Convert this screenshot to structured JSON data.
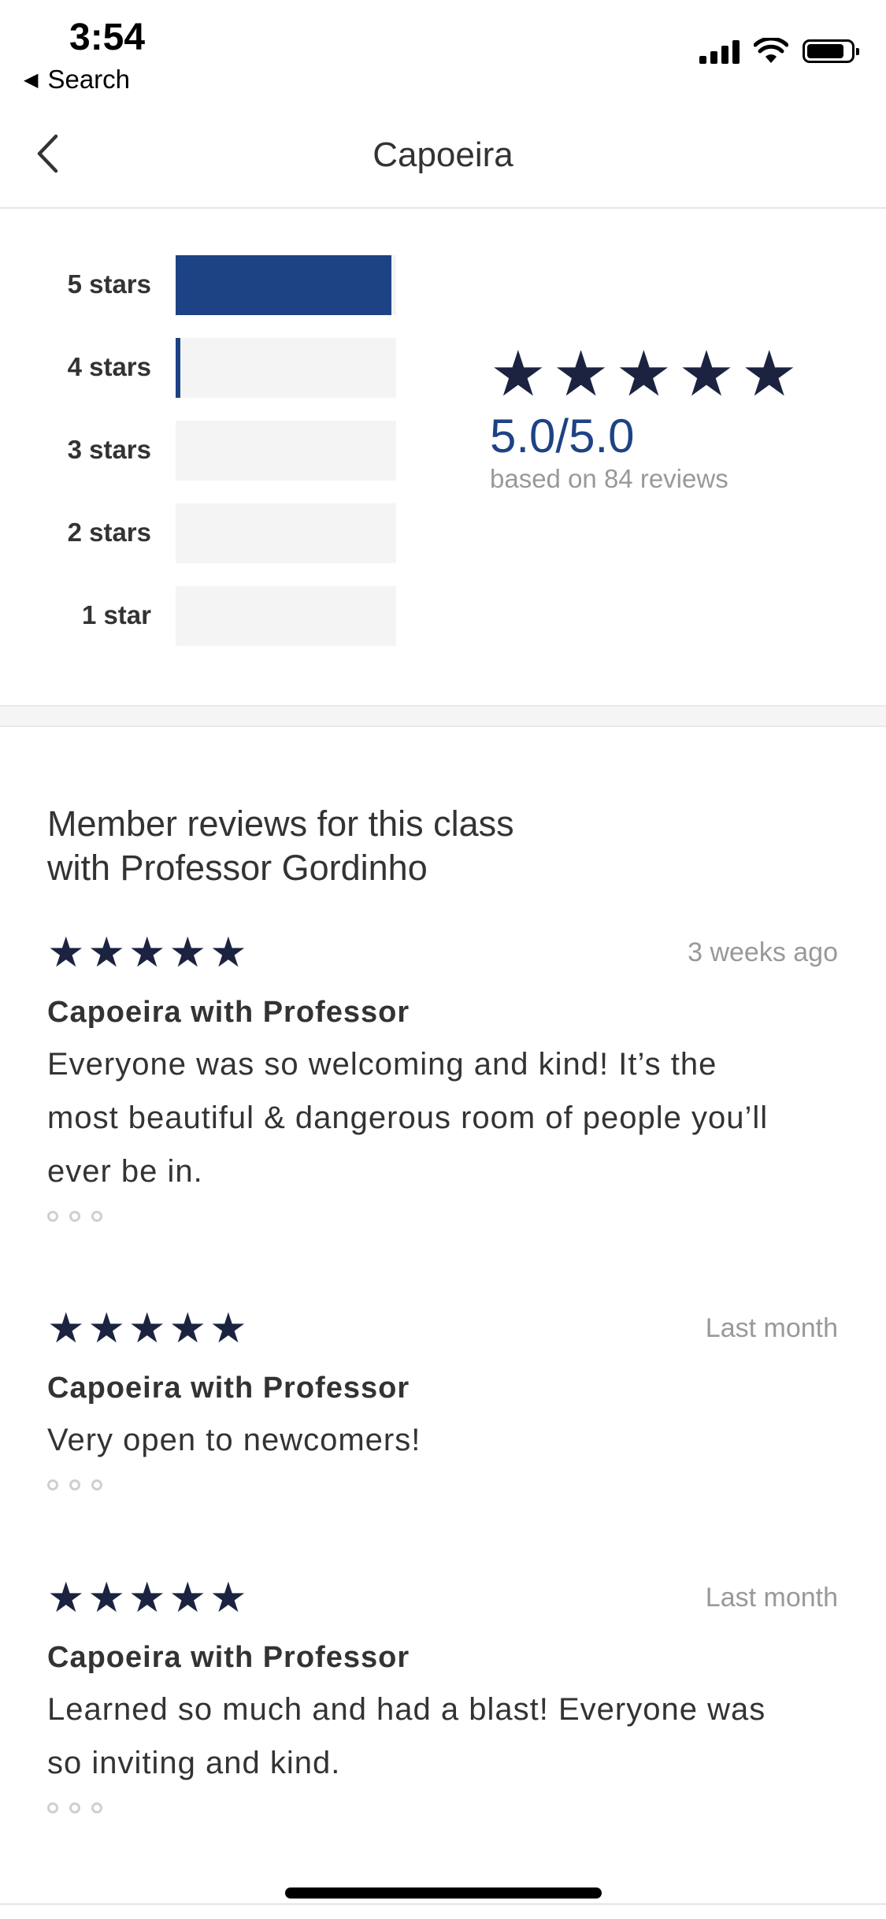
{
  "status_bar": {
    "time": "3:54",
    "back_app_label": "Search",
    "icons": [
      "signal-icon",
      "wifi-icon",
      "battery-icon"
    ]
  },
  "nav": {
    "title": "Capoeira",
    "back_icon": "chevron-left-icon"
  },
  "summary": {
    "rows": [
      {
        "label": "5 stars",
        "fraction": 0.98
      },
      {
        "label": "4 stars",
        "fraction": 0.02
      },
      {
        "label": "3 stars",
        "fraction": 0
      },
      {
        "label": "2 stars",
        "fraction": 0
      },
      {
        "label": "1 star",
        "fraction": 0
      }
    ],
    "star_count": 5,
    "average": "5.0/5.0",
    "based_on": "based on 84 reviews",
    "colors": {
      "bar_fill": "#1d4385",
      "bar_track": "#f4f4f4",
      "star": "#1b2340"
    }
  },
  "reviews": {
    "heading_line1": "Member reviews for this class",
    "heading_line2": "with Professor Gordinho",
    "items": [
      {
        "stars": 5,
        "date": "3 weeks ago",
        "title": "Capoeira with Professor",
        "body_lines": [
          "Everyone was so welcoming and kind! It’s the",
          "most beautiful & dangerous room of people you’ll",
          "ever be in."
        ]
      },
      {
        "stars": 5,
        "date": "Last month",
        "title": "Capoeira with Professor",
        "body_lines": [
          "Very open to newcomers!"
        ]
      },
      {
        "stars": 5,
        "date": "Last month",
        "title": "Capoeira with Professor",
        "body_lines": [
          "Learned so much and had a blast! Everyone was",
          "so inviting and kind."
        ]
      }
    ]
  }
}
